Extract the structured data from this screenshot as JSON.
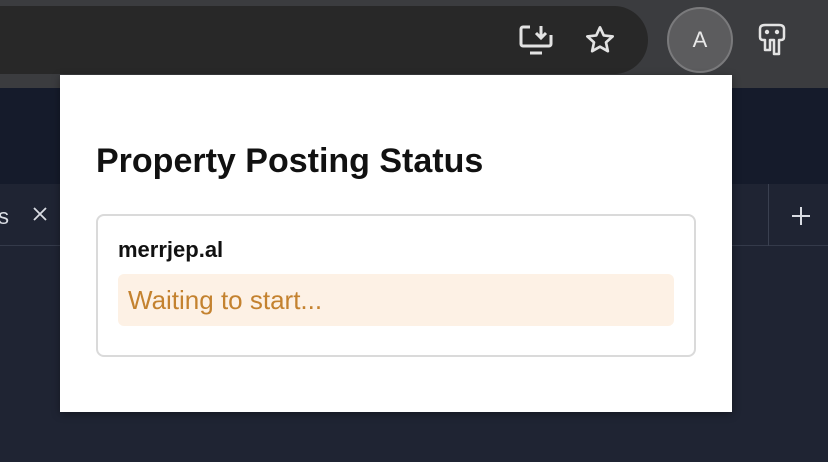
{
  "browser": {
    "profile_initial": "A",
    "icons": {
      "install": "install-app-icon",
      "bookmark": "star-icon",
      "extensions": "extensions-icon"
    }
  },
  "page": {
    "tab_fragment": "s",
    "tab_close_icon": "close-icon",
    "new_tab_icon": "plus-icon"
  },
  "popup": {
    "title": "Property Posting Status",
    "sites": [
      {
        "name": "merrjep.al",
        "status": "Waiting to start..."
      }
    ],
    "colors": {
      "status_text": "#c4822f",
      "status_background": "#fdf1e5"
    }
  }
}
